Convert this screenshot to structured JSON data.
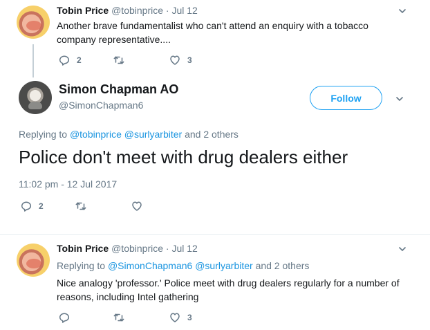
{
  "tweet1": {
    "name": "Tobin Price",
    "handle": "@tobinprice",
    "sep": "·",
    "date": "Jul 12",
    "text": "Another brave fundamentalist who can't attend an enquiry with a tobacco company representative....",
    "replies": "2",
    "likes": "3"
  },
  "main": {
    "name": "Simon Chapman AO",
    "handle": "@SimonChapman6",
    "follow_label": "Follow",
    "replying_prefix": "Replying to",
    "mention1": "@tobinprice",
    "mention2": "@surlyarbiter",
    "and_others": "and 2 others",
    "text": "Police don't meet with drug dealers either",
    "timestamp": "11:02 pm - 12 Jul 2017",
    "replies": "2"
  },
  "tweet3": {
    "name": "Tobin Price",
    "handle": "@tobinprice",
    "sep": "·",
    "date": "Jul 12",
    "replying_prefix": "Replying to",
    "mention1": "@SimonChapman6",
    "mention2": "@surlyarbiter",
    "and_others": "and 2 others",
    "text": "Nice analogy 'professor.' Police meet with drug dealers regularly for a number of reasons, including Intel gathering",
    "likes": "3"
  },
  "icons": {
    "reply": "reply-icon",
    "retweet": "retweet-icon",
    "like": "heart-icon",
    "menu": "chevron-down-icon"
  },
  "colors": {
    "link": "#1b95e0",
    "muted": "#657786",
    "accent": "#1da1f2"
  }
}
